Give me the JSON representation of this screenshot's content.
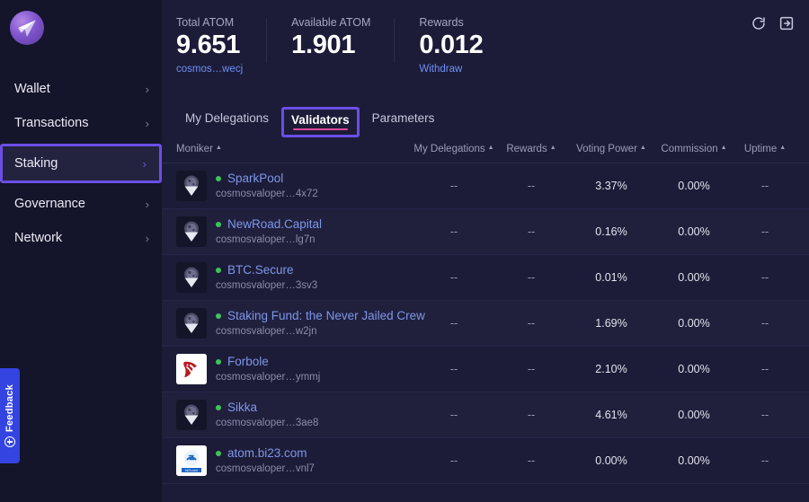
{
  "brand": {
    "logo_icon": "paper-plane-logo"
  },
  "sidebar": {
    "items": [
      {
        "label": "Wallet",
        "icon": "chevron-right-icon",
        "chevron": "›",
        "active": false
      },
      {
        "label": "Transactions",
        "icon": "chevron-right-icon",
        "chevron": "›",
        "active": false
      },
      {
        "label": "Staking",
        "icon": "chevron-right-icon",
        "chevron": "›",
        "active": true
      },
      {
        "label": "Governance",
        "icon": "chevron-right-icon",
        "chevron": "›",
        "active": false
      },
      {
        "label": "Network",
        "icon": "chevron-right-icon",
        "chevron": "›",
        "active": false
      }
    ]
  },
  "feedback": {
    "label": "Feedback",
    "icon": "feedback-circle-icon"
  },
  "header": {
    "stats": [
      {
        "label": "Total ATOM",
        "value": "9.651",
        "sub": "cosmos…wecj",
        "sub_is_link": true
      },
      {
        "label": "Available ATOM",
        "value": "1.901",
        "sub": "",
        "sub_is_link": false
      },
      {
        "label": "Rewards",
        "value": "0.012",
        "sub": "Withdraw",
        "sub_is_link": true
      }
    ],
    "icons": [
      {
        "name": "refresh-icon",
        "title": "Refresh"
      },
      {
        "name": "logout-icon",
        "title": "Sign out"
      }
    ]
  },
  "tabs": [
    {
      "label": "My Delegations",
      "active": false
    },
    {
      "label": "Validators",
      "active": true
    },
    {
      "label": "Parameters",
      "active": false
    }
  ],
  "table": {
    "columns": [
      {
        "label": "Moniker",
        "sort": "▲",
        "key": "moniker"
      },
      {
        "label": "My Delegations",
        "sort": "▲",
        "key": "delegations"
      },
      {
        "label": "Rewards",
        "sort": "▲",
        "key": "rewards"
      },
      {
        "label": "Voting Power",
        "sort": "▲",
        "key": "voting_power"
      },
      {
        "label": "Commission",
        "sort": "▲",
        "key": "commission"
      },
      {
        "label": "Uptime",
        "sort": "▲",
        "key": "uptime"
      }
    ],
    "rows": [
      {
        "moniker": "SparkPool",
        "address": "cosmosvaloper…4x72",
        "status": "active",
        "avatar": "default-pin-avatar",
        "delegations": "--",
        "rewards": "--",
        "voting_power": "3.37%",
        "commission": "0.00%",
        "uptime": "--"
      },
      {
        "moniker": "NewRoad.Capital",
        "address": "cosmosvaloper…lg7n",
        "status": "active",
        "avatar": "default-pin-avatar",
        "delegations": "--",
        "rewards": "--",
        "voting_power": "0.16%",
        "commission": "0.00%",
        "uptime": "--"
      },
      {
        "moniker": "BTC.Secure",
        "address": "cosmosvaloper…3sv3",
        "status": "active",
        "avatar": "default-pin-avatar",
        "delegations": "--",
        "rewards": "--",
        "voting_power": "0.01%",
        "commission": "0.00%",
        "uptime": "--"
      },
      {
        "moniker": "Staking Fund: the Never Jailed Crew",
        "address": "cosmosvaloper…w2jn",
        "status": "active",
        "avatar": "default-pin-avatar",
        "delegations": "--",
        "rewards": "--",
        "voting_power": "1.69%",
        "commission": "0.00%",
        "uptime": "--"
      },
      {
        "moniker": "Forbole",
        "address": "cosmosvaloper…ymmj",
        "status": "active",
        "avatar": "forbole-horse-avatar",
        "delegations": "--",
        "rewards": "--",
        "voting_power": "2.10%",
        "commission": "0.00%",
        "uptime": "--"
      },
      {
        "moniker": "Sikka",
        "address": "cosmosvaloper…3ae8",
        "status": "active",
        "avatar": "default-pin-avatar",
        "delegations": "--",
        "rewards": "--",
        "voting_power": "4.61%",
        "commission": "0.00%",
        "uptime": "--"
      },
      {
        "moniker": "atom.bi23.com",
        "address": "cosmosvaloper…vnl7",
        "status": "active",
        "avatar": "bi23-avatar",
        "delegations": "--",
        "rewards": "--",
        "voting_power": "0.00%",
        "commission": "0.00%",
        "uptime": "--"
      }
    ]
  },
  "colors": {
    "sidebar_bg": "#14142a",
    "main_bg": "#1c1c38",
    "row_alt_bg": "#20203d",
    "accent_purple": "#6b4ee8",
    "accent_pink": "#e0499b",
    "link_blue": "#7e96e8",
    "status_green": "#3fc45a",
    "feedback_blue": "#3344e0"
  }
}
